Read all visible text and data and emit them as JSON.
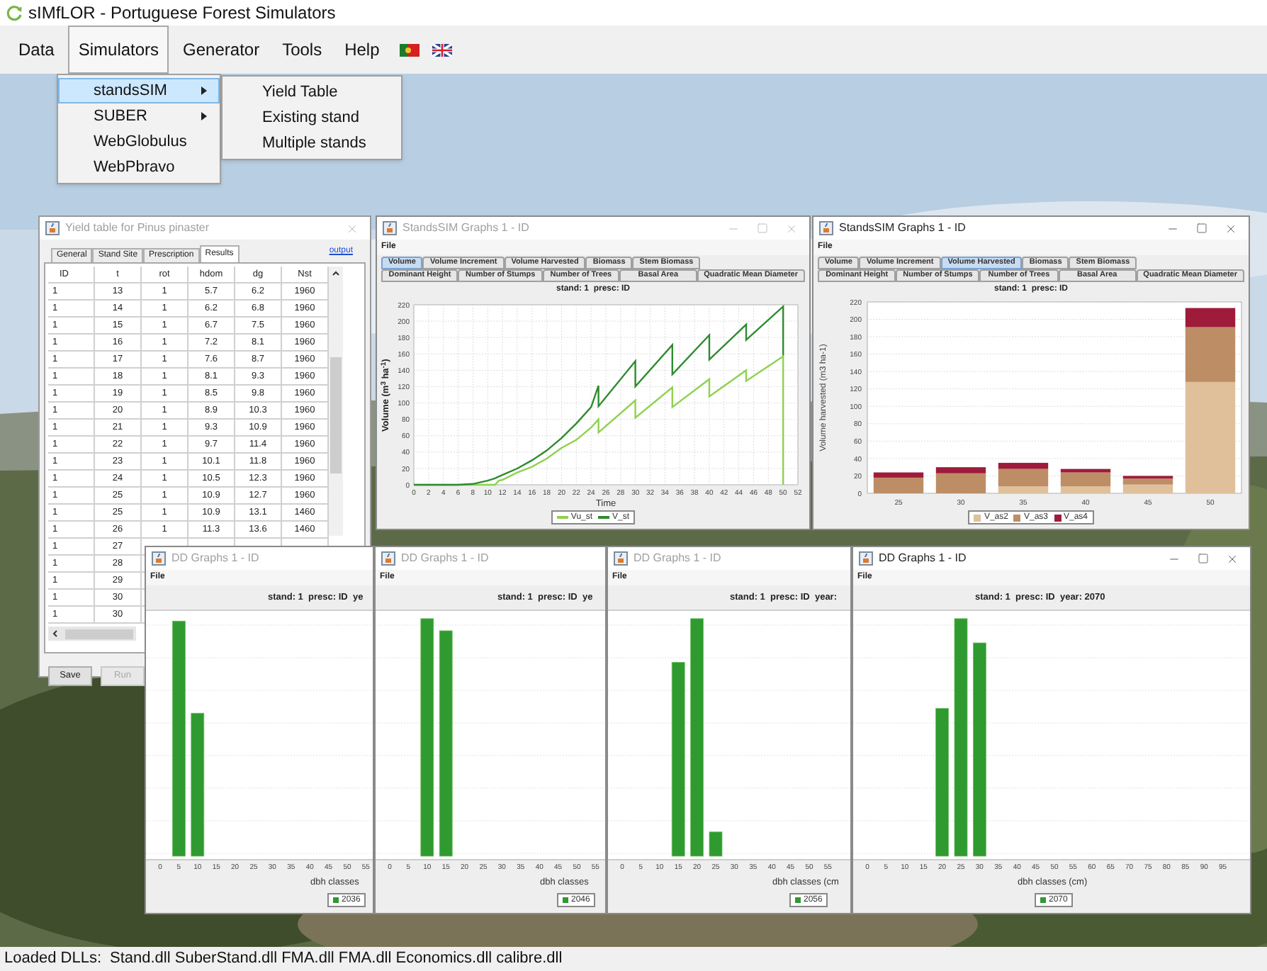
{
  "window": {
    "title": "sIMfLOR - Portuguese Forest Simulators"
  },
  "menu_bar": [
    {
      "label": "Data",
      "selected": false
    },
    {
      "label": "Simulators",
      "selected": true
    },
    {
      "label": "Generator",
      "selected": false
    },
    {
      "label": "Tools",
      "selected": false
    },
    {
      "label": "Help",
      "selected": false
    }
  ],
  "simulators_menu": [
    {
      "label": "standsSIM",
      "selected": true,
      "submenu": true
    },
    {
      "label": "SUBER",
      "selected": false,
      "submenu": true
    },
    {
      "label": "WebGlobulus",
      "selected": false,
      "submenu": false
    },
    {
      "label": "WebPbravo",
      "selected": false,
      "submenu": false
    }
  ],
  "standssim_submenu": [
    {
      "label": "Yield Table"
    },
    {
      "label": "Existing stand"
    },
    {
      "label": "Multiple stands"
    }
  ],
  "yield_table_window": {
    "title": "Yield table for Pinus pinaster",
    "active": false,
    "tabs": [
      {
        "label": "General",
        "selected": false
      },
      {
        "label": "Stand Site",
        "selected": false
      },
      {
        "label": "Prescription",
        "selected": false
      },
      {
        "label": "Results",
        "selected": true
      }
    ],
    "output_link": "output",
    "columns": [
      "ID",
      "t",
      "rot",
      "hdom",
      "dg",
      "Nst"
    ],
    "rows": [
      [
        "1",
        "13",
        "1",
        "5.7",
        "6.2",
        "1960"
      ],
      [
        "1",
        "14",
        "1",
        "6.2",
        "6.8",
        "1960"
      ],
      [
        "1",
        "15",
        "1",
        "6.7",
        "7.5",
        "1960"
      ],
      [
        "1",
        "16",
        "1",
        "7.2",
        "8.1",
        "1960"
      ],
      [
        "1",
        "17",
        "1",
        "7.6",
        "8.7",
        "1960"
      ],
      [
        "1",
        "18",
        "1",
        "8.1",
        "9.3",
        "1960"
      ],
      [
        "1",
        "19",
        "1",
        "8.5",
        "9.8",
        "1960"
      ],
      [
        "1",
        "20",
        "1",
        "8.9",
        "10.3",
        "1960"
      ],
      [
        "1",
        "21",
        "1",
        "9.3",
        "10.9",
        "1960"
      ],
      [
        "1",
        "22",
        "1",
        "9.7",
        "11.4",
        "1960"
      ],
      [
        "1",
        "23",
        "1",
        "10.1",
        "11.8",
        "1960"
      ],
      [
        "1",
        "24",
        "1",
        "10.5",
        "12.3",
        "1960"
      ],
      [
        "1",
        "25",
        "1",
        "10.9",
        "12.7",
        "1960"
      ],
      [
        "1",
        "25",
        "1",
        "10.9",
        "13.1",
        "1460"
      ],
      [
        "1",
        "26",
        "1",
        "11.3",
        "13.6",
        "1460"
      ],
      [
        "1",
        "27"
      ],
      [
        "1",
        "28"
      ],
      [
        "1",
        "29"
      ],
      [
        "1",
        "30"
      ],
      [
        "1",
        "30"
      ]
    ],
    "buttons": [
      {
        "label": "Save",
        "disabled": false
      },
      {
        "label": "Run",
        "disabled": true
      }
    ]
  },
  "standssim_windows": [
    {
      "title": "StandsSIM Graphs 1 - ID",
      "active": false,
      "menu": "File",
      "tab_rows": [
        [
          {
            "label": "Volume",
            "selected": true
          },
          {
            "label": "Volume Increment",
            "selected": false
          },
          {
            "label": "Volume Harvested",
            "selected": false
          },
          {
            "label": "Biomass",
            "selected": false
          },
          {
            "label": "Stem Biomass",
            "selected": false
          }
        ],
        [
          {
            "label": "Dominant Height",
            "selected": false
          },
          {
            "label": "Number of Stumps",
            "selected": false
          },
          {
            "label": "Number of Trees",
            "selected": false
          },
          {
            "label": "Basal Area",
            "selected": false
          },
          {
            "label": "Quadratic Mean Diameter",
            "selected": false
          }
        ]
      ],
      "chart_data": {
        "type": "line",
        "title": "stand: 1  presc: ID",
        "xlabel": "Time",
        "ylabel": "Volume (m$^{3}$ ha$^{-1}$)",
        "x": [
          0,
          2,
          4,
          6,
          8,
          10,
          11,
          11.5,
          12,
          14,
          16,
          18,
          20,
          22,
          24,
          25,
          25,
          30,
          30,
          35,
          35,
          40,
          40,
          45,
          45,
          50,
          50
        ],
        "series": [
          {
            "name": "Vu_st",
            "color": "#8fd14f",
            "values": [
              0,
              0,
              0,
              0,
              0,
              0,
              0,
              5,
              6,
              15,
              22,
              32,
              45,
              55,
              70,
              80,
              64,
              103,
              82,
              119,
              95,
              129,
              108,
              140,
              127,
              157,
              0
            ]
          },
          {
            "name": "V_st",
            "color": "#2e8b2e",
            "values": [
              0,
              0,
              0,
              0,
              1,
              5,
              8,
              10,
              12,
              20,
              30,
              42,
              57,
              75,
              95,
              121,
              96,
              151,
              120,
              171,
              135,
              183,
              153,
              196,
              177,
              218,
              158
            ]
          }
        ],
        "xlim": [
          0,
          52
        ],
        "ylim": [
          0,
          220
        ],
        "xticks": [
          0,
          2,
          4,
          6,
          8,
          10,
          12,
          14,
          16,
          18,
          20,
          22,
          24,
          26,
          28,
          30,
          32,
          34,
          36,
          38,
          40,
          42,
          44,
          46,
          48,
          50,
          52
        ],
        "yticks": [
          0,
          20,
          40,
          60,
          80,
          100,
          120,
          140,
          160,
          180,
          200,
          220
        ],
        "grid": true,
        "legend": true
      }
    },
    {
      "title": "StandsSIM Graphs 1 - ID",
      "active": true,
      "menu": "File",
      "tab_rows": [
        [
          {
            "label": "Volume",
            "selected": false
          },
          {
            "label": "Volume Increment",
            "selected": false
          },
          {
            "label": "Volume Harvested",
            "selected": true
          },
          {
            "label": "Biomass",
            "selected": false
          },
          {
            "label": "Stem Biomass",
            "selected": false
          }
        ],
        [
          {
            "label": "Dominant Height",
            "selected": false
          },
          {
            "label": "Number of Stumps",
            "selected": false
          },
          {
            "label": "Number of Trees",
            "selected": false
          },
          {
            "label": "Basal Area",
            "selected": false
          },
          {
            "label": "Quadratic Mean Diameter",
            "selected": false
          }
        ]
      ],
      "chart_data": {
        "type": "bar",
        "stacked": true,
        "title": "stand: 1  presc: ID",
        "ylabel": "Volume harvested (m3 ha-1)",
        "categories": [
          "25",
          "30",
          "35",
          "40",
          "45",
          "50"
        ],
        "series": [
          {
            "name": "V_as2",
            "color": "#dfc09a",
            "values": [
              0,
              0,
              8,
              8,
              10,
              128
            ]
          },
          {
            "name": "V_as3",
            "color": "#bd8e65",
            "values": [
              18,
              23,
              20,
              16,
              7,
              63
            ]
          },
          {
            "name": "V_as4",
            "color": "#9e1b3a",
            "values": [
              6,
              7,
              7,
              4,
              3,
              22
            ]
          }
        ],
        "ylim": [
          0,
          220
        ],
        "yticks": [
          0,
          20,
          40,
          60,
          80,
          100,
          120,
          140,
          160,
          180,
          200,
          220
        ],
        "grid": true,
        "legend": true
      }
    }
  ],
  "dd_windows": [
    {
      "title": "DD Graphs 1 - ID",
      "active": false,
      "controls": false,
      "menu": "File",
      "plot_title": "stand: 1  presc: ID  ye",
      "xticks": [
        "0",
        "5",
        "10",
        "15",
        "20",
        "25",
        "30",
        "35",
        "40",
        "45",
        "50",
        "55"
      ],
      "xlabel": "dbh classes",
      "legend": "2036"
    },
    {
      "title": "DD Graphs 1 - ID",
      "active": false,
      "controls": false,
      "menu": "File",
      "plot_title": "stand: 1  presc: ID  ye",
      "xticks": [
        "0",
        "5",
        "10",
        "15",
        "20",
        "25",
        "30",
        "35",
        "40",
        "45",
        "50",
        "55"
      ],
      "xlabel": "dbh classes",
      "legend": "2046"
    },
    {
      "title": "DD Graphs 1 - ID",
      "active": false,
      "controls": false,
      "menu": "File",
      "plot_title": "stand: 1  presc: ID  year:",
      "xticks": [
        "0",
        "5",
        "10",
        "15",
        "20",
        "25",
        "30",
        "35",
        "40",
        "45",
        "50",
        "55"
      ],
      "xlabel": "dbh classes (cm",
      "legend": "2056"
    },
    {
      "title": "DD Graphs 1 - ID",
      "active": true,
      "controls": true,
      "menu": "File",
      "plot_title": "stand: 1  presc: ID  year: 2070",
      "xticks": [
        "0",
        "5",
        "10",
        "15",
        "20",
        "25",
        "30",
        "35",
        "40",
        "45",
        "50",
        "55",
        "60",
        "65",
        "70",
        "75",
        "80",
        "85",
        "90",
        "95"
      ],
      "xlabel": "dbh classes (cm)",
      "legend": "2070"
    }
  ],
  "status_bar": {
    "label": "Loaded DLLs:",
    "text": "Stand.dll SuberStand.dll FMA.dll FMA.dll Economics.dll calibre.dll"
  }
}
